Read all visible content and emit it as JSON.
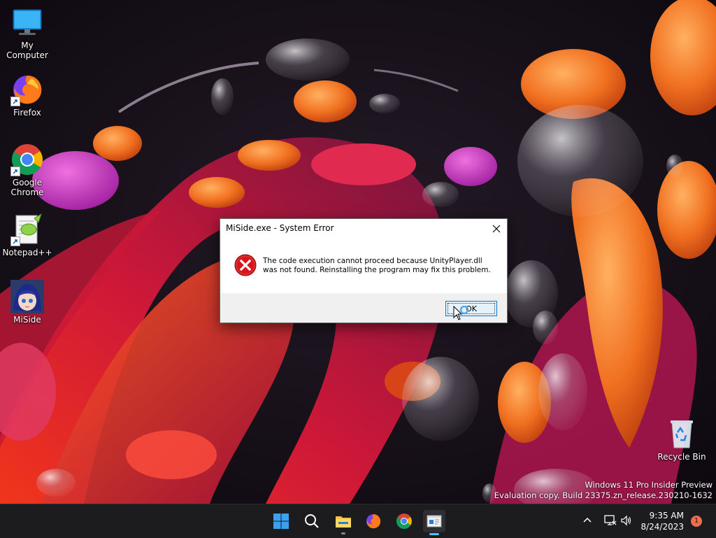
{
  "desktop": {
    "icons": [
      {
        "label": "My Computer",
        "icon": "monitor-icon"
      },
      {
        "label": "Firefox",
        "icon": "firefox-icon"
      },
      {
        "label": "Google Chrome",
        "icon": "chrome-icon"
      },
      {
        "label": "Notepad++",
        "icon": "notepadpp-icon"
      },
      {
        "label": "MiSide",
        "icon": "miside-icon"
      },
      {
        "label": "Recycle Bin",
        "icon": "recycle-bin-icon"
      }
    ],
    "watermark": {
      "line1": "Windows 11 Pro Insider Preview",
      "line2": "Evaluation copy. Build 23375.zn_release.230210-1632"
    }
  },
  "dialog": {
    "title": "MiSide.exe - System Error",
    "message_line1": "The code execution cannot proceed because UnityPlayer.dll",
    "message_line2": "was not found. Reinstalling the program may fix this problem.",
    "ok_label": "OK",
    "icon": "error-icon"
  },
  "taskbar": {
    "items": [
      "start-icon",
      "search-icon",
      "file-explorer-icon",
      "firefox-icon",
      "chrome-icon",
      "app-window-icon"
    ],
    "clock": {
      "time": "9:35 AM",
      "date": "8/24/2023"
    },
    "notification_count": "1"
  },
  "colors": {
    "accent": "#0078d7",
    "error_red": "#d7161b",
    "taskbar": "#1c1c1f"
  }
}
